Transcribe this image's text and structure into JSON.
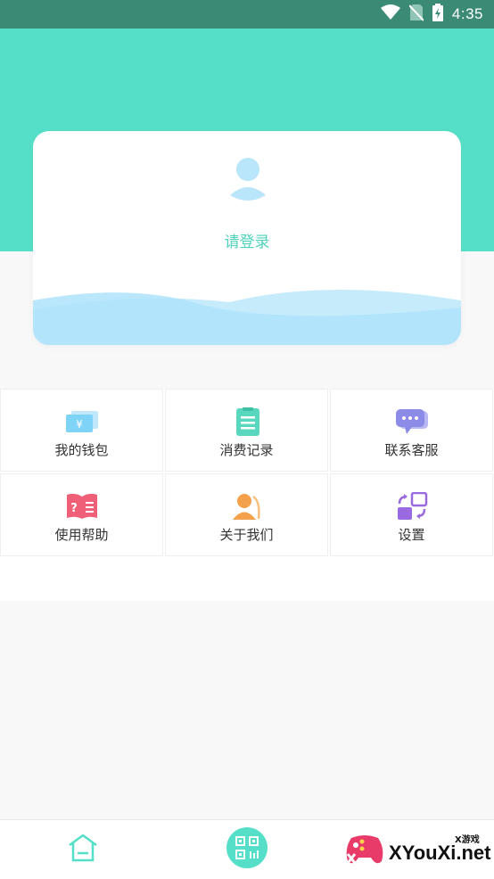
{
  "status_bar": {
    "time": "4:35",
    "icons": [
      "wifi-icon",
      "no-sim-icon",
      "battery-charging-icon"
    ]
  },
  "colors": {
    "accent": "#56dfc8",
    "status_bar": "#3a8a76",
    "login_text": "#4fd2bb",
    "wave": "#aee6fb"
  },
  "profile": {
    "login_label": "请登录",
    "avatar_icon": "user-avatar-icon"
  },
  "menu": {
    "items": [
      {
        "label": "我的钱包",
        "icon": "wallet-icon"
      },
      {
        "label": "消费记录",
        "icon": "record-list-icon"
      },
      {
        "label": "联系客服",
        "icon": "chat-bubble-icon"
      },
      {
        "label": "使用帮助",
        "icon": "help-book-icon"
      },
      {
        "label": "关于我们",
        "icon": "person-info-icon"
      },
      {
        "label": "设置",
        "icon": "settings-swap-icon"
      }
    ]
  },
  "bottom_nav": {
    "items": [
      {
        "name": "home",
        "icon": "home-icon"
      },
      {
        "name": "scan",
        "icon": "qr-scan-icon"
      },
      {
        "name": "profile",
        "icon": "game-controller-icon"
      }
    ]
  },
  "watermark": {
    "text": "XYouXi.net",
    "sub": "X游戏"
  }
}
